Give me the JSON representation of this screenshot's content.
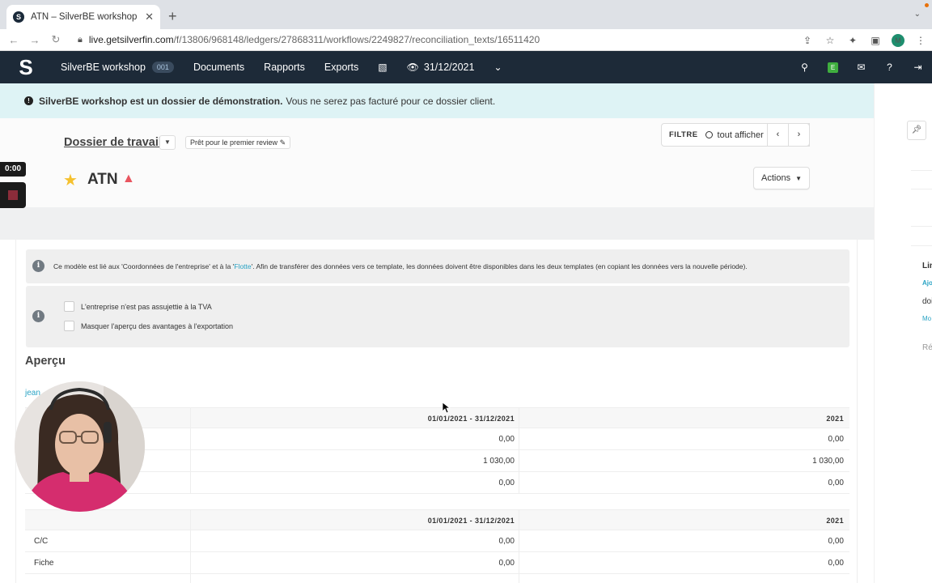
{
  "browser": {
    "tab_title": "ATN – SilverBE workshop (Wor",
    "url_host": "live.getsilverfin.com",
    "url_path": "/f/13806/968148/ledgers/27868311/workflows/2249827/reconciliation_texts/16511420",
    "profile_initial": "M"
  },
  "app": {
    "logo_letter": "S",
    "firm_name": "SilverBE workshop",
    "firm_badge": "001",
    "nav": [
      "Documents",
      "Rapports",
      "Exports"
    ],
    "period": "31/12/2021",
    "green_badge": "E"
  },
  "banner": {
    "bold": "SilverBE workshop est un dossier de démonstration.",
    "text": "Vous ne serez pas facturé pour ce dossier client."
  },
  "header": {
    "dossier": "Dossier de travail",
    "status": "Prêt pour le premier review",
    "filter_label": "FILTRE",
    "filter_value": "tout afficher",
    "title": "ATN",
    "actions": "Actions"
  },
  "recorder": {
    "time": "0:00"
  },
  "info": {
    "text1": "Ce modèle est lié aux 'Coordonnées de l'entreprise' et à la '",
    "link": "Flotte",
    "text2": "'. Afin de transférer des données vers ce template, les données doivent être disponibles dans les deux templates (en copiant les données vers la nouvelle période)."
  },
  "options": {
    "vat": "L'entreprise n'est pas assujettie à la TVA",
    "hide": "Masquer l'aperçu des avantages à l'exportation"
  },
  "apercu": {
    "title": "Aperçu",
    "author": "jean",
    "col1": "01/01/2021 - 31/12/2021",
    "col2": "2021",
    "table1": [
      {
        "label": "",
        "v1": "0,00",
        "v2": "0,00"
      },
      {
        "label": "",
        "v1": "1 030,00",
        "v2": "1 030,00"
      },
      {
        "label": "",
        "v1": "0,00",
        "v2": "0,00"
      }
    ],
    "table2": [
      {
        "label": "C/C",
        "v1": "0,00",
        "v2": "0,00"
      },
      {
        "label": "Fiche",
        "v1": "0,00",
        "v2": "0,00"
      },
      {
        "label": "",
        "v1": "",
        "v2": ""
      }
    ]
  },
  "right_panel": {
    "t1": "Lin",
    "l1": "Ajo",
    "t2": "doi",
    "l2": "Mo",
    "t3": "Ré"
  }
}
